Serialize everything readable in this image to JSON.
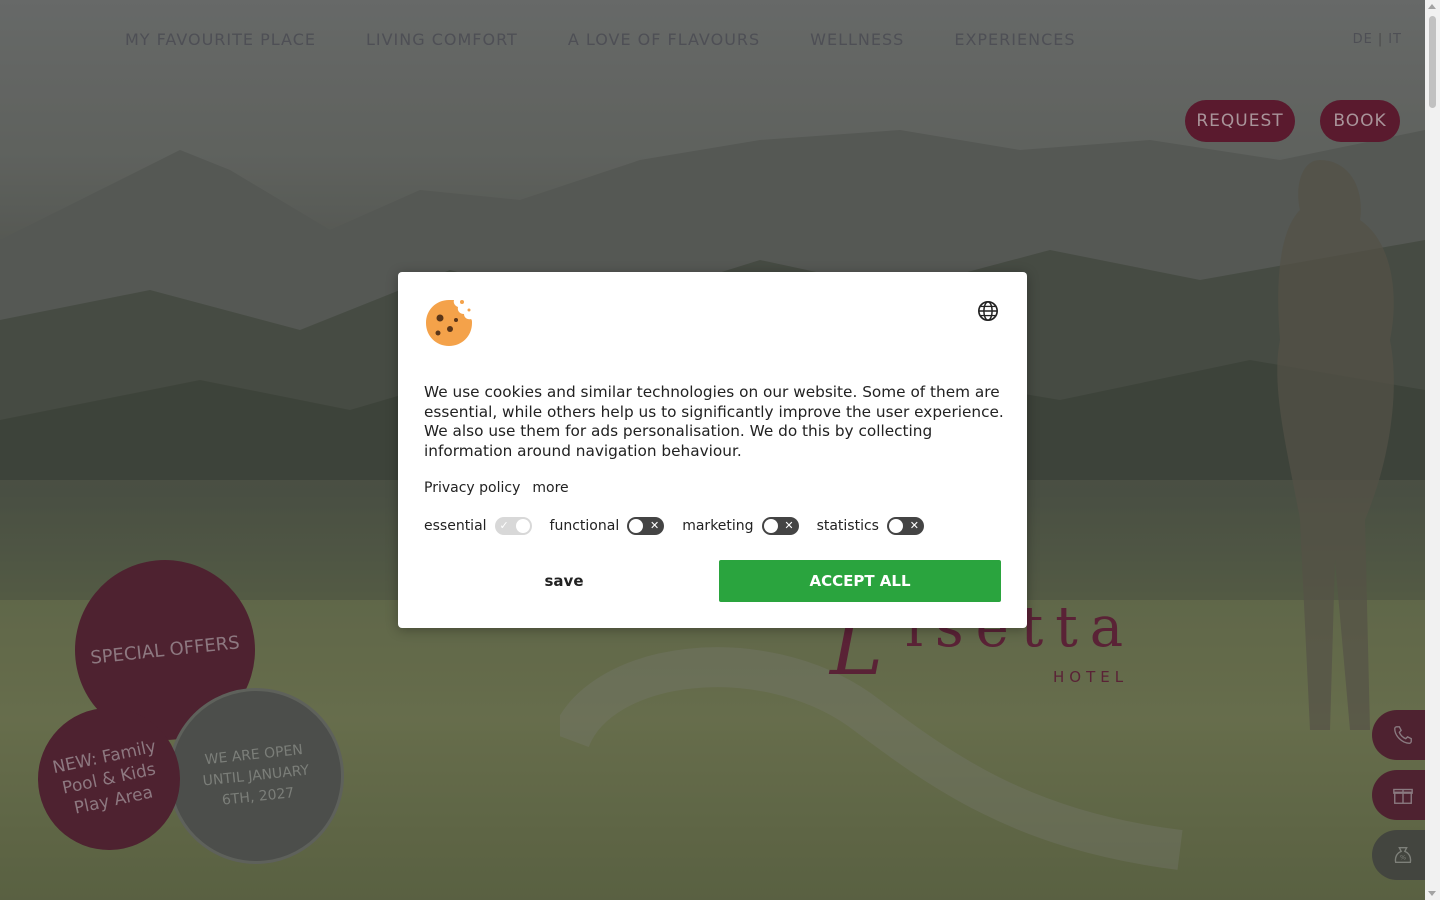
{
  "nav": {
    "items": [
      {
        "label": "MY FAVOURITE PLACE"
      },
      {
        "label": "LIVING COMFORT"
      },
      {
        "label": "A LOVE OF FLAVOURS"
      },
      {
        "label": "WELLNESS"
      },
      {
        "label": "EXPERIENCES"
      }
    ],
    "languages": [
      "DE",
      "IT"
    ],
    "language_separator": "|",
    "request_label": "REQUEST",
    "book_label": "BOOK"
  },
  "logo": {
    "initial": "L",
    "name": "isetta",
    "subtitle": "HOTEL"
  },
  "bubbles": {
    "offers": "SPECIAL OFFERS",
    "new_feature": "NEW: Family Pool & Kids Play Area",
    "open_until": "WE ARE OPEN UNTIL JANUARY 6TH, 2027"
  },
  "side_actions": {
    "phone_icon": "phone-icon",
    "gift_icon": "gift-icon",
    "offer_icon": "discount-bag-icon"
  },
  "cookie_banner": {
    "icon": "cookie-icon",
    "language_icon": "globe-icon",
    "text": "We use cookies and similar technologies on our website. Some of them are essential, while others help us to significantly improve the user experience. We also use them for ads personalisation. We do this by collecting information around navigation behaviour.",
    "privacy_link": "Privacy policy",
    "more_link": "more",
    "toggles": [
      {
        "label": "essential",
        "enabled": true,
        "locked": true
      },
      {
        "label": "functional",
        "enabled": false
      },
      {
        "label": "marketing",
        "enabled": false
      },
      {
        "label": "statistics",
        "enabled": false
      }
    ],
    "save_label": "save",
    "accept_label": "ACCEPT ALL"
  },
  "colors": {
    "brand": "#5a1a2e",
    "accept": "#2aa43e",
    "overlay": "rgba(60,60,60,0.45)"
  }
}
